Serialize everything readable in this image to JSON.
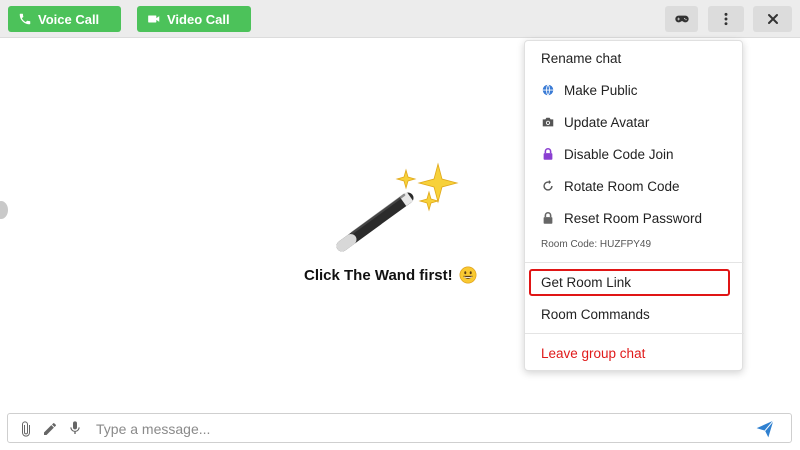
{
  "header": {
    "voice_call_label": "Voice Call",
    "video_call_label": "Video Call",
    "icons": [
      "phone-icon",
      "video-camera-icon",
      "gamepad-icon",
      "more-vertical-icon",
      "close-icon"
    ]
  },
  "main": {
    "prompt_text": "Click The Wand first!",
    "illustration": "magic-wand-sparkles",
    "emoji": "grinning-face"
  },
  "menu": {
    "items": [
      {
        "label": "Rename chat",
        "icon": ""
      },
      {
        "label": "Make Public",
        "icon": "globe-icon"
      },
      {
        "label": "Update Avatar",
        "icon": "camera-icon"
      },
      {
        "label": "Disable Code Join",
        "icon": "lock-icon"
      },
      {
        "label": "Rotate Room Code",
        "icon": "rotate-icon"
      },
      {
        "label": "Reset Room Password",
        "icon": "lock-icon"
      }
    ],
    "room_code": "Room Code: HUZFPY49",
    "get_room_link": "Get Room Link",
    "room_commands": "Room Commands",
    "leave_group_chat": "Leave group chat"
  },
  "composer": {
    "placeholder": "Type a message...",
    "icons": [
      "paperclip-icon",
      "pencil-icon",
      "microphone-icon",
      "send-icon"
    ]
  },
  "colors": {
    "call_button": "#4cc25a",
    "toolbar_bg": "#ececec",
    "danger": "#e01a1a",
    "highlight_border": "#e01515",
    "send_icon": "#2f80d0",
    "lock_purple": "#8a3fd1"
  }
}
